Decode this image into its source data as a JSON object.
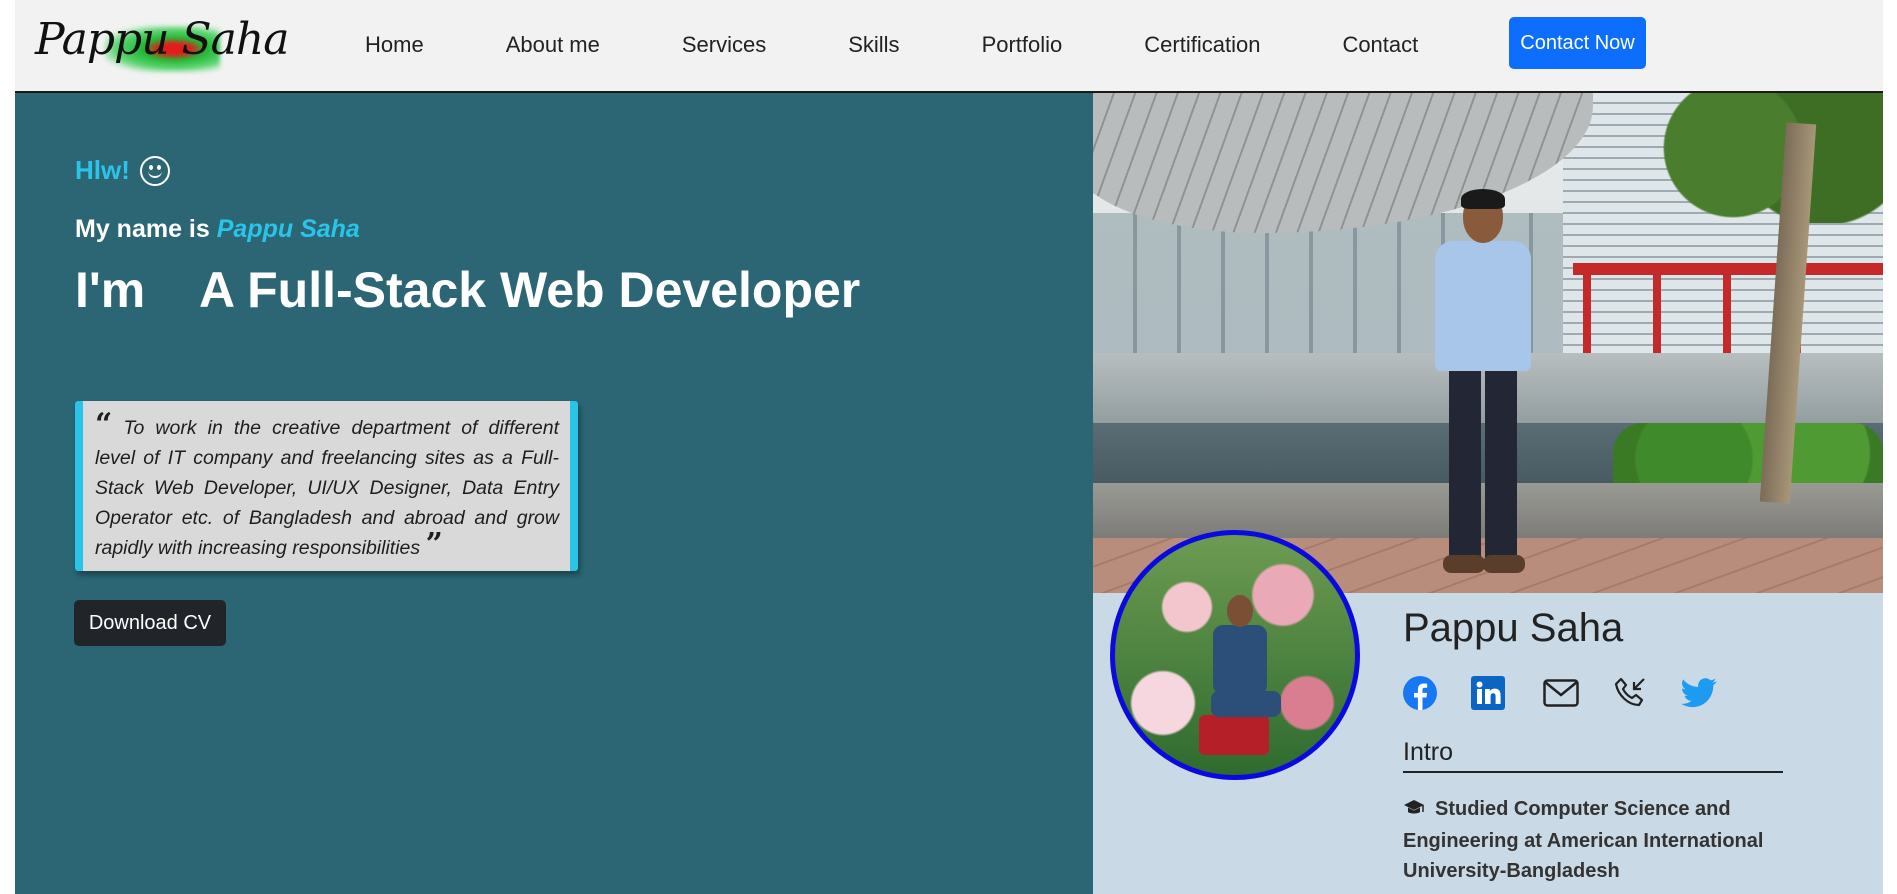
{
  "nav": {
    "logo_text": "Pappu Saha",
    "links": [
      "Home",
      "About me",
      "Services",
      "Skills",
      "Portfolio",
      "Certification",
      "Contact"
    ],
    "cta_label": "Contact Now"
  },
  "hero": {
    "greeting": "Hlw!",
    "name_prefix": "My name is",
    "name": "Pappu Saha",
    "role_prefix": "I'm",
    "role": "A Full-Stack Web Developer",
    "quote": "To work in the creative department of different level of IT company and freelancing sites as a Full-Stack Web Developer, UI/UX Designer, Data Entry Operator etc. of Bangladesh and abroad and grow rapidly with increasing responsibilities",
    "download_label": "Download CV"
  },
  "profile": {
    "name": "Pappu Saha",
    "socials": [
      "facebook-icon",
      "linkedin-icon",
      "mail-icon",
      "phone-icon",
      "twitter-icon"
    ],
    "intro_title": "Intro",
    "intro_text": "Studied Computer Science and Engineering at American International University-Bangladesh"
  },
  "colors": {
    "hero_bg": "#2c6675",
    "accent": "#29c4e8",
    "cta": "#0d6efd",
    "card_bg": "#c9d9e5",
    "avatar_border": "#0a0ae0"
  }
}
